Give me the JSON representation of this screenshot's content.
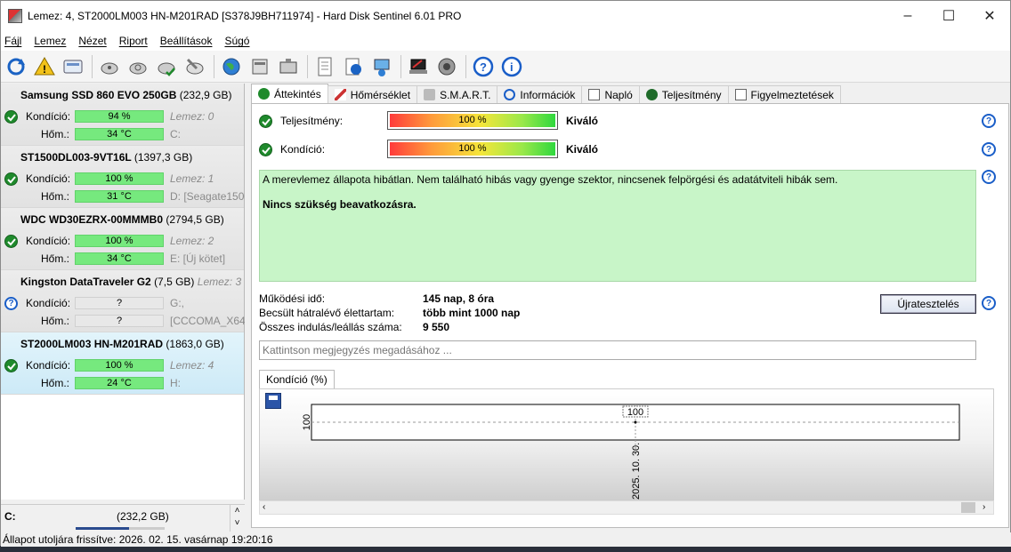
{
  "window": {
    "title": "Lemez: 4, ST2000LM003 HN-M201RAD [S378J9BH711974]  -  Hard Disk Sentinel 6.01 PRO"
  },
  "menu": [
    "Fájl",
    "Lemez",
    "Nézet",
    "Riport",
    "Beállítások",
    "Súgó"
  ],
  "disks": [
    {
      "name": "Samsung SSD 860 EVO 250GB",
      "capacity": "(232,9 GB)",
      "disk_num": "",
      "condition": "94 %",
      "condition_level": 0.94,
      "temp": "34 °C",
      "lemez": "Lemez: 0",
      "volume": "C:",
      "status": "ok",
      "cond_label": "Kondíció:",
      "temp_label": "Hőm.:",
      "selected": false
    },
    {
      "name": "ST1500DL003-9VT16L",
      "capacity": "(1397,3 GB)",
      "disk_num": "",
      "condition": "100 %",
      "condition_level": 1.0,
      "temp": "31 °C",
      "lemez": "Lemez: 1",
      "volume": "D: [Seagate1500",
      "status": "ok",
      "cond_label": "Kondíció:",
      "temp_label": "Hőm.:",
      "selected": false
    },
    {
      "name": "WDC WD30EZRX-00MMMB0",
      "capacity": "(2794,5 GB)",
      "disk_num": "",
      "condition": "100 %",
      "condition_level": 1.0,
      "temp": "34 °C",
      "lemez": "Lemez: 2",
      "volume": "E: [Új kötet]",
      "status": "ok",
      "cond_label": "Kondíció:",
      "temp_label": "Hőm.:",
      "selected": false
    },
    {
      "name": "Kingston DataTraveler G2",
      "capacity": "(7,5 GB)",
      "disk_num": "Lemez: 3",
      "condition": "?",
      "condition_level": 0,
      "temp": "?",
      "lemez": "G:,",
      "volume": "[CCCOMA_X64",
      "status": "unknown",
      "cond_label": "Kondíció:",
      "temp_label": "Hőm.:",
      "selected": false
    },
    {
      "name": "ST2000LM003 HN-M201RAD",
      "capacity": "(1863,0 GB)",
      "disk_num": "",
      "condition": "100 %",
      "condition_level": 1.0,
      "temp": "24 °C",
      "lemez": "Lemez: 4",
      "volume": "H:",
      "status": "ok",
      "cond_label": "Kondíció:",
      "temp_label": "Hőm.:",
      "selected": true
    }
  ],
  "left_footer": {
    "drive": "C:",
    "capacity": "(232,2 GB)"
  },
  "tabs": [
    "Áttekintés",
    "Hőmérséklet",
    "S.M.A.R.T.",
    "Információk",
    "Napló",
    "Teljesítmény",
    "Figyelmeztetések"
  ],
  "overview": {
    "performance_label": "Teljesítmény:",
    "performance_value": "100 %",
    "performance_rating": "Kiváló",
    "condition_label": "Kondíció:",
    "condition_value": "100 %",
    "condition_rating": "Kiváló",
    "description": "A merevlemez állapota hibátlan. Nem található hibás vagy gyenge szektor, nincsenek felpörgési és adatátviteli hibák sem.",
    "recommendation": "Nincs szükség beavatkozásra.",
    "info": [
      {
        "key": "Működési idő:",
        "value": "145 nap, 8 óra"
      },
      {
        "key": "Becsült hátralévő élettartam:",
        "value": "több mint 1000 nap"
      },
      {
        "key": "Összes indulás/leállás száma:",
        "value": "9 550"
      }
    ],
    "retest_label": "Újratesztelés",
    "note_placeholder": "Kattintson megjegyzés megadásához ..."
  },
  "chart_data": {
    "type": "line",
    "title": "Kondíció  (%)",
    "x": [
      "2025. 10. 30."
    ],
    "series": [
      {
        "values": [
          100
        ]
      }
    ],
    "y_tick_labels": [
      "100"
    ],
    "data_labels": [
      "100"
    ]
  },
  "statusbar": "Állapot utoljára frissítve: 2026. 02. 15. vasárnap 19:20:16"
}
